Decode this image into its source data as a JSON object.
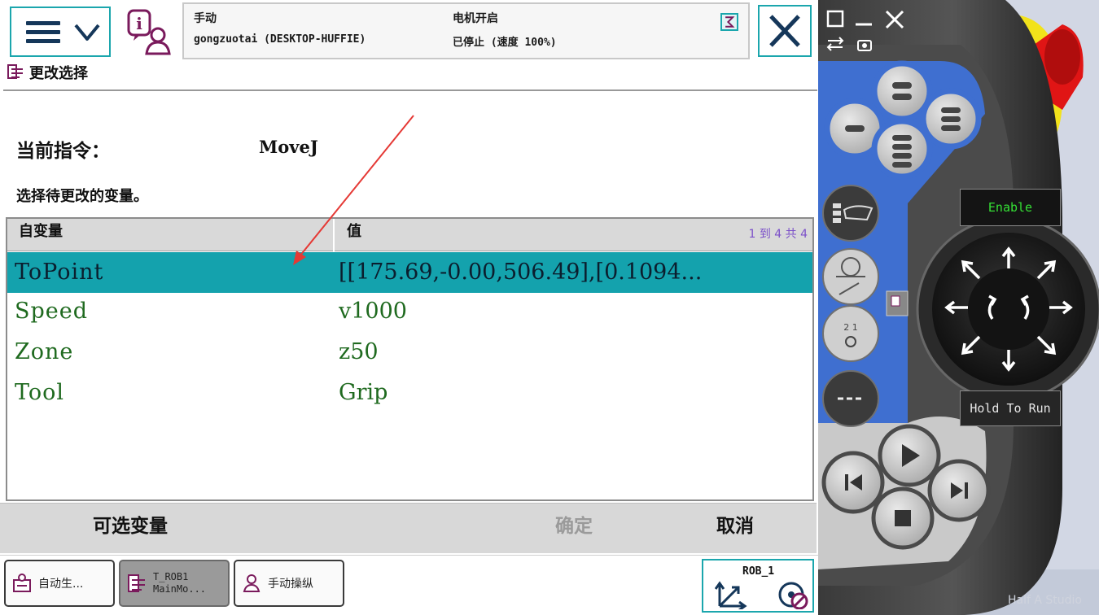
{
  "window": {
    "menu_icon": "hamburger-menu-icon",
    "info_icon": "event-log-icon",
    "close_icon": "close-icon"
  },
  "status": {
    "mode": "手动",
    "station": "gongzuotai (DESKTOP-HUFFIE)",
    "motor": "电机开启",
    "state": "已停止 (速度 100%)"
  },
  "breadcrumb": {
    "title": "更改选择"
  },
  "current": {
    "label": "当前指令：",
    "value": "MoveJ"
  },
  "instruction": "选择待更改的变量。",
  "table": {
    "headers": {
      "name": "自变量",
      "value": "值",
      "count": "1 到 4 共 4"
    },
    "rows": [
      {
        "name": "ToPoint",
        "value": "[[175.69,-0.00,506.49],[0.1094...",
        "selected": true
      },
      {
        "name": "Speed",
        "value": "v1000",
        "selected": false
      },
      {
        "name": "Zone",
        "value": "z50",
        "selected": false
      },
      {
        "name": "Tool",
        "value": "Grip",
        "selected": false
      }
    ]
  },
  "actions": {
    "optional": "可选变量",
    "ok": "确定",
    "cancel": "取消"
  },
  "taskbar": {
    "auto": "自动生...",
    "rob_line1": "T_ROB1",
    "rob_line2": "MainMo...",
    "jog": "手动操纵",
    "quickset_label": "ROB_1"
  },
  "pendant": {
    "enable": "Enable",
    "hold_to_run": "Hold To Run"
  },
  "watermark": "Half A Studio",
  "colors": {
    "accent": "#14a2ad",
    "selected_row": "#14a2ad",
    "value_text": "#1f6a1f",
    "disabled_text": "#9a9a9a",
    "count_text": "#7b4fc9",
    "annotation_arrow": "#e53935",
    "pendant_blue": "#3f6fd0",
    "pendant_yellow": "#f2e21b",
    "emergency_red": "#e01515"
  }
}
